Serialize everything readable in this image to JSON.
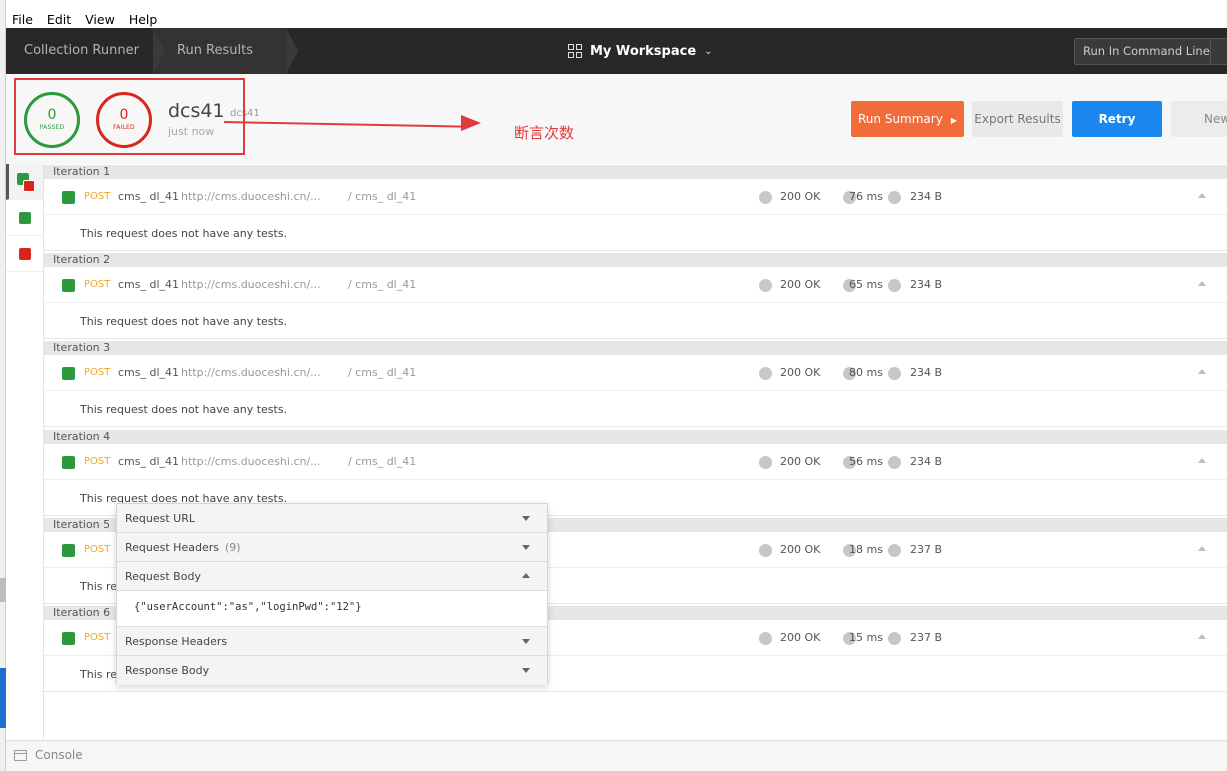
{
  "menu": [
    "File",
    "Edit",
    "View",
    "Help"
  ],
  "header": {
    "breadcrumbs": [
      "Collection Runner",
      "Run Results"
    ],
    "workspace": "My Workspace",
    "run_in_command_line": "Run In Command Line"
  },
  "summary": {
    "passed_count": "0",
    "passed_label": "PASSED",
    "failed_count": "0",
    "failed_label": "FAILED",
    "run_name": "dcs41",
    "environment": "dcs41",
    "time": "just now",
    "annotation": "断言次数",
    "buttons": {
      "run_summary": "Run Summary",
      "export": "Export Results",
      "retry": "Retry",
      "new": "New"
    }
  },
  "colors": {
    "passed": "#2c9a3c",
    "failed": "#d9261c",
    "run_summary": "#f26b3a",
    "retry": "#1a87f0",
    "method": "#f5a623"
  },
  "iterations": [
    {
      "label": "Iteration 1",
      "method": "POST",
      "name": "cms_ dl_41",
      "url": "http://cms.duoceshi.cn/...",
      "path": "/ cms_ dl_41",
      "status": "200 OK",
      "time": "76 ms",
      "size": "234 B",
      "test_msg": "This request does not have any tests."
    },
    {
      "label": "Iteration 2",
      "method": "POST",
      "name": "cms_ dl_41",
      "url": "http://cms.duoceshi.cn/...",
      "path": "/ cms_ dl_41",
      "status": "200 OK",
      "time": "65 ms",
      "size": "234 B",
      "test_msg": "This request does not have any tests."
    },
    {
      "label": "Iteration 3",
      "method": "POST",
      "name": "cms_ dl_41",
      "url": "http://cms.duoceshi.cn/...",
      "path": "/ cms_ dl_41",
      "status": "200 OK",
      "time": "80 ms",
      "size": "234 B",
      "test_msg": "This request does not have any tests."
    },
    {
      "label": "Iteration 4",
      "method": "POST",
      "name": "cms_ dl_41",
      "url": "http://cms.duoceshi.cn/...",
      "path": "/ cms_ dl_41",
      "status": "200 OK",
      "time": "56 ms",
      "size": "234 B",
      "test_msg": "This request does not have any tests."
    },
    {
      "label": "Iteration 5",
      "method": "POST",
      "name": "",
      "url": "",
      "path": "",
      "status": "200 OK",
      "time": "18 ms",
      "size": "237 B",
      "test_msg": "This req"
    },
    {
      "label": "Iteration 6",
      "method": "POST",
      "name": "",
      "url": "",
      "path": "",
      "status": "200 OK",
      "time": "15 ms",
      "size": "237 B",
      "test_msg": "This req"
    }
  ],
  "panel": {
    "request_url": "Request URL",
    "request_headers": "Request Headers",
    "request_headers_count": "(9)",
    "request_body": "Request Body",
    "body_content": "{\"userAccount\":\"as\",\"loginPwd\":\"12\"}",
    "response_headers": "Response Headers",
    "response_body": "Response Body"
  },
  "console": {
    "label": "Console"
  }
}
